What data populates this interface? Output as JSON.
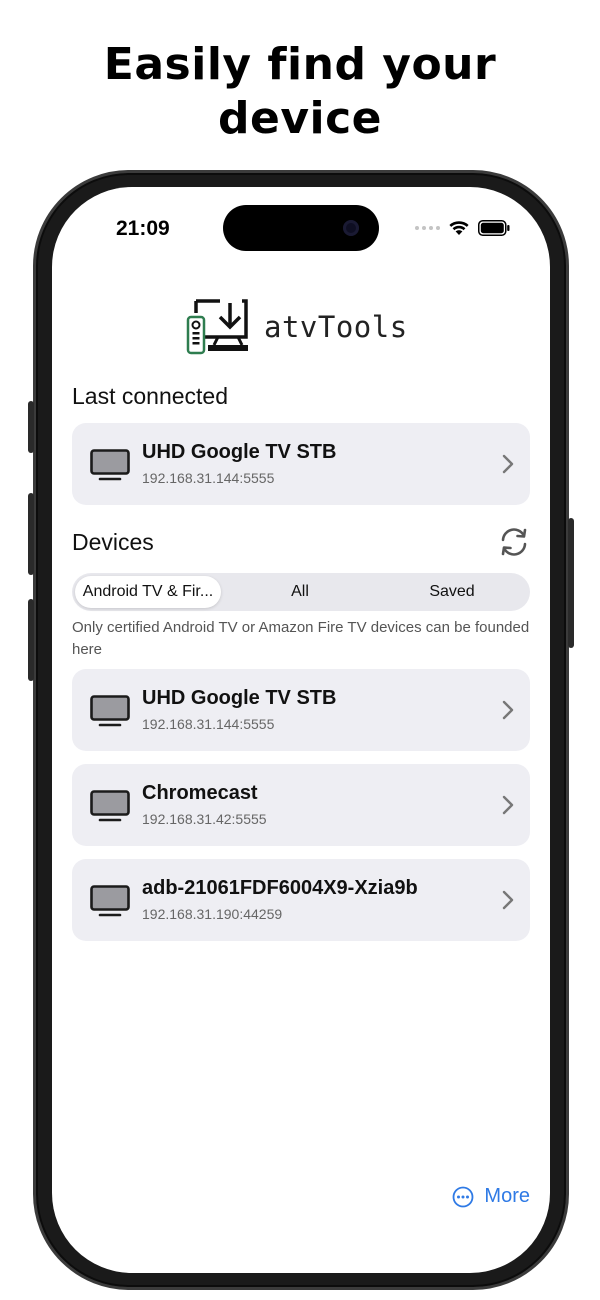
{
  "headline": {
    "line1": "Easily find your",
    "line2": "device"
  },
  "status_bar": {
    "time": "21:09"
  },
  "app": {
    "name": "atvTools"
  },
  "last_connected": {
    "title": "Last connected",
    "device": {
      "name": "UHD Google TV STB",
      "address": "192.168.31.144:5555"
    }
  },
  "devices": {
    "title": "Devices",
    "tabs": [
      {
        "label": "Android TV & Fir...",
        "active": true
      },
      {
        "label": "All",
        "active": false
      },
      {
        "label": "Saved",
        "active": false
      }
    ],
    "note": "Only certified Android TV or Amazon Fire TV devices can be founded here",
    "list": [
      {
        "name": "UHD Google TV STB",
        "address": "192.168.31.144:5555"
      },
      {
        "name": "Chromecast",
        "address": "192.168.31.42:5555"
      },
      {
        "name": "adb-21061FDF6004X9-Xzia9b",
        "address": "192.168.31.190:44259"
      }
    ]
  },
  "more": {
    "label": "More"
  },
  "colors": {
    "accent": "#2f7ae5",
    "card": "#eeeef3",
    "logo_green": "#2e7d4f"
  },
  "icons": [
    "tv-icon",
    "chevron-right-icon",
    "refresh-icon",
    "more-circle-icon",
    "wifi-icon",
    "battery-icon"
  ]
}
